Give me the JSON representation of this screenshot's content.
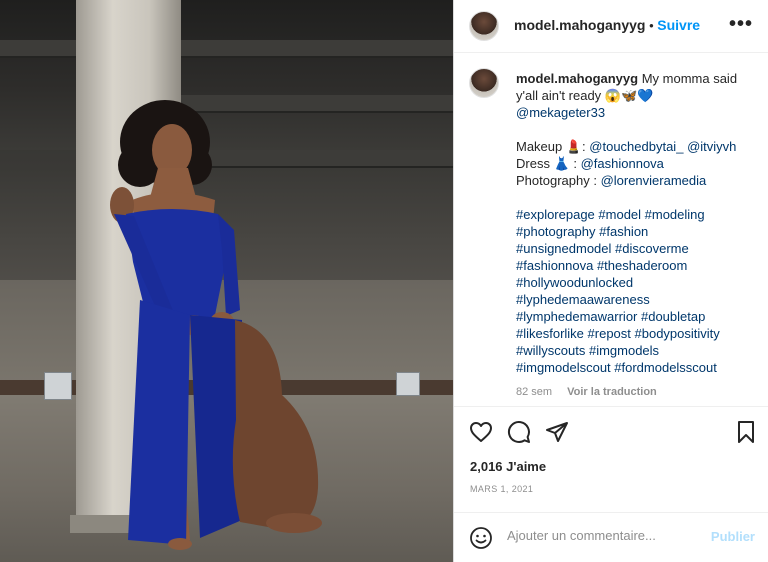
{
  "post": {
    "photo_alt": "model in blue dress leaning on a pillar in a parking garage",
    "sign_left": "",
    "sign_right": ""
  },
  "header": {
    "username": "model.mahoganyyg",
    "separator": "•",
    "follow_label": "Suivre",
    "more_label": "•••"
  },
  "caption": {
    "username": "model.mahoganyyg",
    "text_line1": "My momma said",
    "text_line2": "y'all ain't ready 😱🦋💙",
    "mention": "@mekageter33",
    "makeup_label": "Makeup 💄: ",
    "makeup_link1": "@touchedbytai_",
    "makeup_link2": "@itviyvh",
    "dress_label": "Dress 👗 : ",
    "dress_link": "@fashionnova",
    "photo_label": "Photography : ",
    "photo_link": "@lorenvieramedia",
    "hashtags": [
      "#explorepage #model #modeling",
      "#photography #fashion",
      "#unsignedmodel #discoverme",
      "#fashionnova #theshaderoom",
      "#hollywoodunlocked",
      "#lyphedemaawareness",
      "#lymphedemawarrior #doubletap",
      "#likesforlike #repost #bodypositivity",
      "#willyscouts #imgmodels",
      "#imgmodelscout #fordmodelsscout"
    ],
    "age": "82 sem",
    "translate_label": "Voir la traduction"
  },
  "actions": {
    "like_icon": "heart-icon",
    "comment_icon": "comment-icon",
    "share_icon": "paper-plane-icon",
    "save_icon": "bookmark-icon"
  },
  "likes": "2,016 J'aime",
  "date": "MARS 1, 2021",
  "comment": {
    "placeholder": "Ajouter un commentaire...",
    "value": "",
    "publish_label": "Publier",
    "emoji_icon": "emoji-icon"
  },
  "colors": {
    "accent": "#0095f6",
    "link": "#00376b",
    "muted": "#8e8e8e",
    "publish_disabled": "#b2dffc",
    "dress": "#1b2fa0"
  }
}
